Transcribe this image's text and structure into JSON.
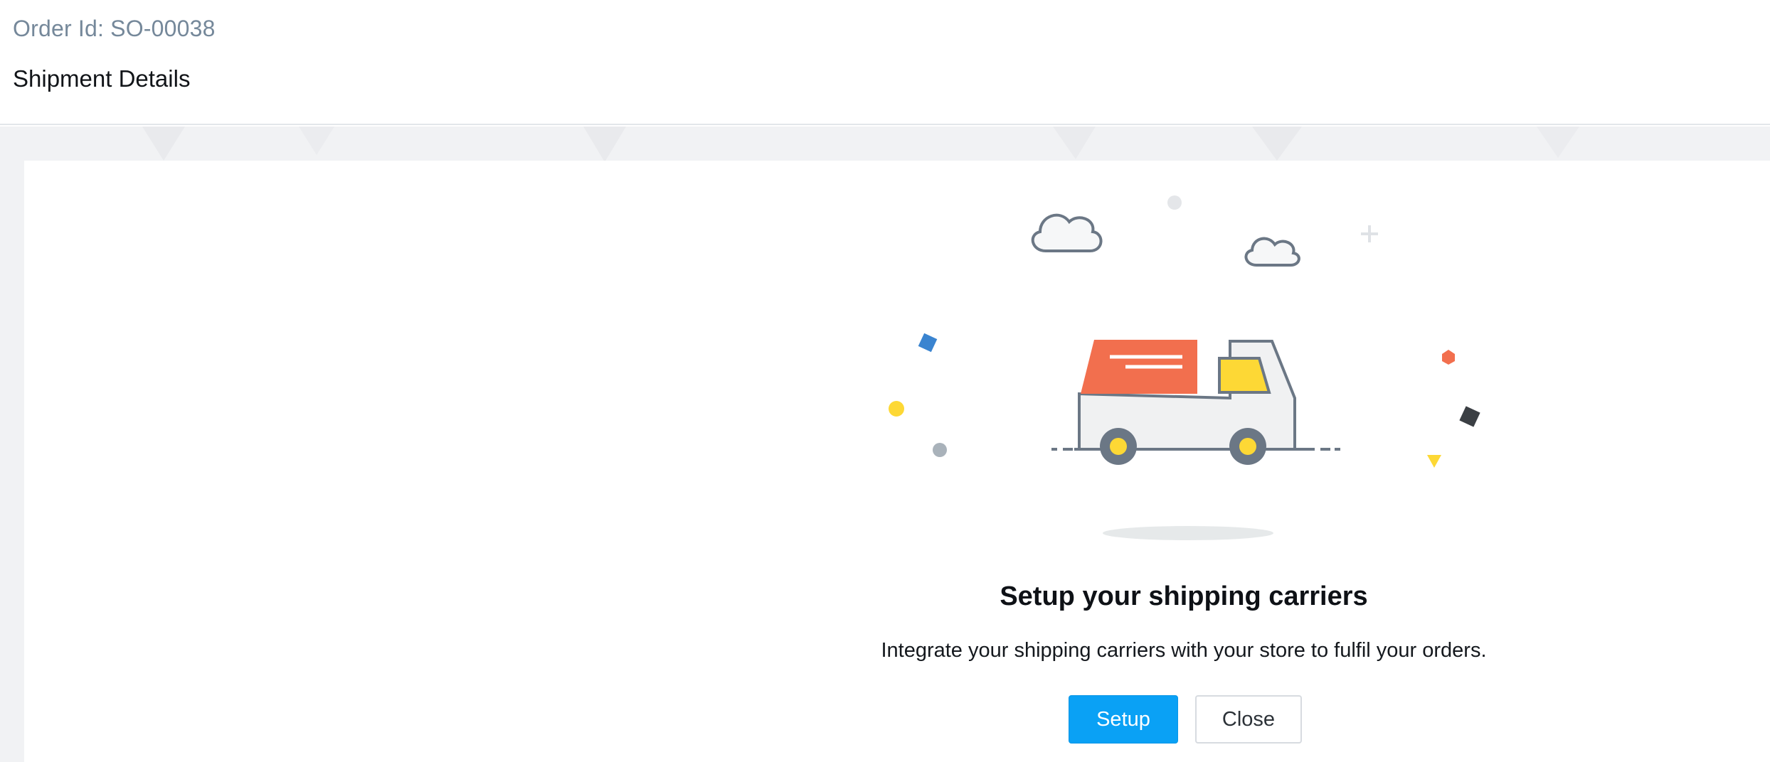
{
  "header": {
    "order_id": "Order Id: SO-00038",
    "title": "Shipment Details"
  },
  "empty_state": {
    "illustration_icon": "delivery-truck-illustration",
    "title": "Setup your shipping carriers",
    "description": "Integrate your shipping carriers with your store to fulfil your orders.",
    "setup_label": "Setup",
    "close_label": "Close"
  },
  "colors": {
    "primary": "#0aa1f5",
    "truck_body": "#f26f4e",
    "truck_window": "#fdd835",
    "outline": "#6b7785"
  }
}
